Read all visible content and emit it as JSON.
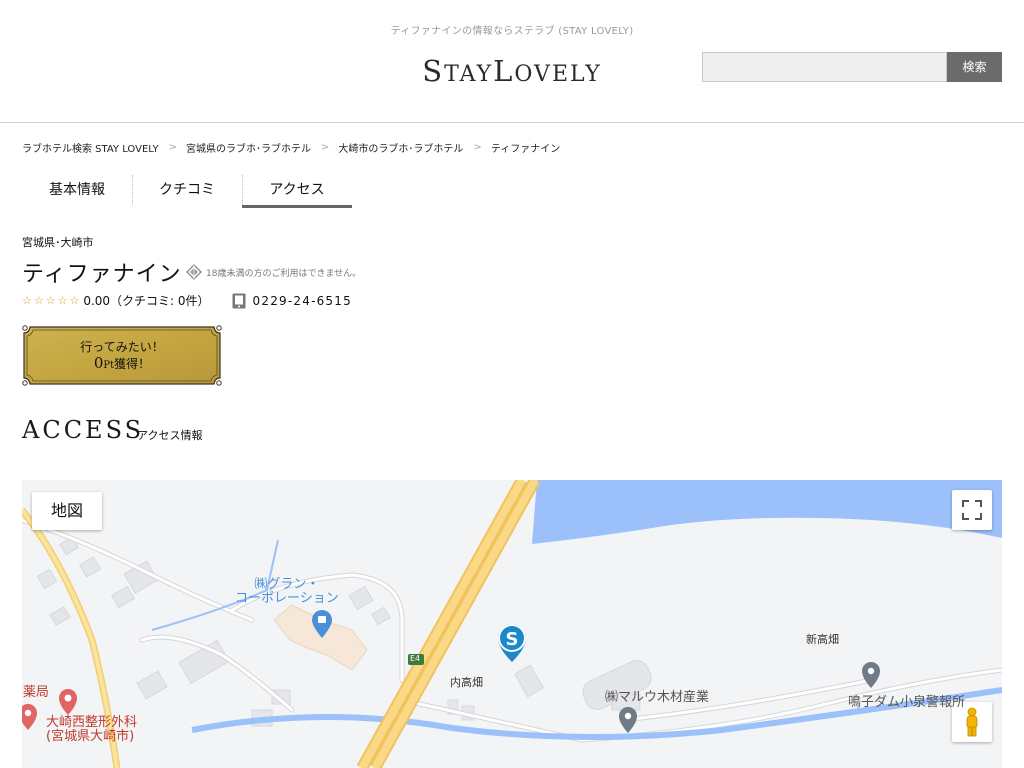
{
  "header": {
    "tagline": "ティファナインの情報ならステラブ (STAY LOVELY)",
    "logo_part1": "S",
    "logo_part2": "TAY",
    "logo_part3": "L",
    "logo_part4": "OVELY",
    "search_placeholder": "",
    "search_button": "検索"
  },
  "breadcrumb": [
    "ラブホテル検索 STAY LOVELY",
    "宮城県のラブホ･ラブホテル",
    "大崎市のラブホ･ラブホテル",
    "ティファナイン"
  ],
  "breadcrumb_sep": ">",
  "tabs": [
    "基本情報",
    "クチコミ",
    "アクセス"
  ],
  "hotel": {
    "area": "宮城県･大崎市",
    "name": "ティファナイン",
    "age_note": "18歳未満の方のご利用はできません。",
    "stars": "☆☆☆☆☆",
    "rating_text": "0.00（クチコミ: 0件）",
    "phone": "0229-24-6515"
  },
  "wish_button": {
    "line1": "行ってみたい！",
    "points": "0",
    "unit": "Pt",
    "suffix": "獲得！"
  },
  "access": {
    "title": "ACCESS",
    "subtitle": "アクセス情報"
  },
  "map": {
    "map_type_button": "地図",
    "labels": {
      "gran_line1": "㈱グラン・",
      "gran_line2": "コーポレーション",
      "uchitakabatake": "内高畑",
      "shintakabatake": "新高畑",
      "maruu": "㈱マルウ木材産業",
      "police": "鳴子ダム小泉警報所",
      "pharmacy": "I薬局",
      "clinic_line1": "大崎西整形外科",
      "clinic_line2": "(宮城県大崎市)",
      "route": "E4"
    },
    "colors": {
      "water": "#9cc0f9",
      "road_major": "#f7d37a",
      "land": "#f3f4f6",
      "building": "#e6e8eb"
    }
  }
}
